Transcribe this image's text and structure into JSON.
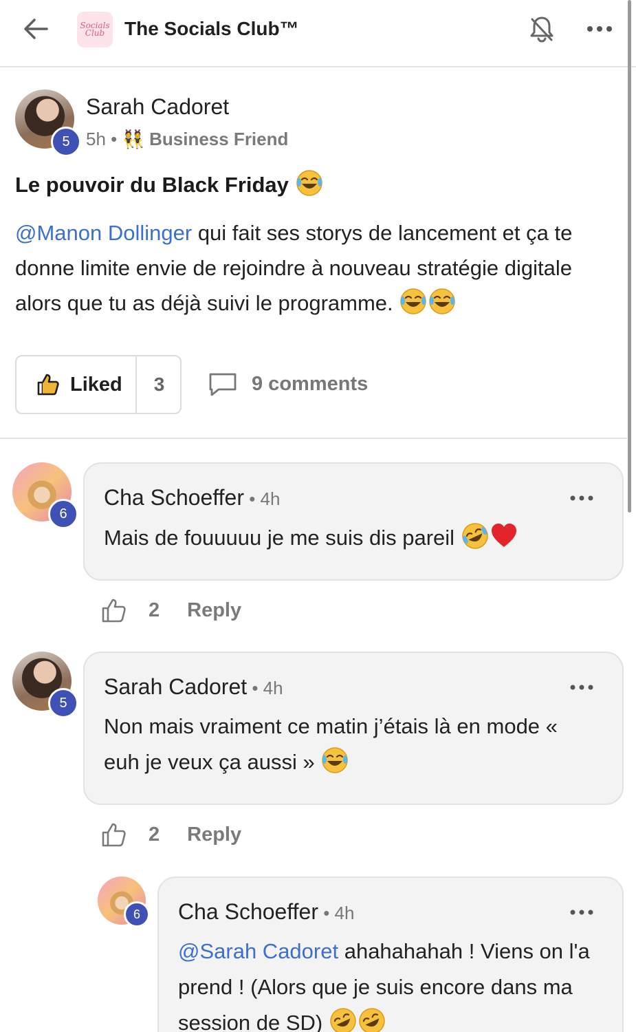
{
  "header": {
    "logo_text": "Socials Club",
    "title": "The Socials Club™",
    "icons": {
      "back": "arrow-left-icon",
      "bell": "bell-off-icon",
      "more": "more-horizontal-icon"
    }
  },
  "post": {
    "author": "Sarah Cadoret",
    "level": "5",
    "time": "5h",
    "separator": "•",
    "role": "Business Friend",
    "title": "Le pouvoir du Black Friday",
    "mention": "@Manon Dollinger",
    "body": " qui fait ses storys de lancement et ça te donne limite envie de rejoindre à nouveau stratégie digitale alors que tu as déjà suivi le programme. ",
    "liked_label": "Liked",
    "like_count": "3",
    "comments_label": "9 comments"
  },
  "comments": [
    {
      "author": "Cha Schoeffer",
      "level": "6",
      "time": " • 4h",
      "text": "Mais de fouuuuu je me suis dis pareil ",
      "likes": "2",
      "reply_label": "Reply"
    },
    {
      "author": "Sarah Cadoret",
      "level": "5",
      "time": " • 4h",
      "text": "Non mais vraiment ce matin j’étais là en mode « euh je veux ça aussi » ",
      "likes": "2",
      "reply_label": "Reply"
    },
    {
      "author": "Cha Schoeffer",
      "level": "6",
      "time": " • 4h",
      "mention": "@Sarah Cadoret",
      "text": " ahahahahah ! Viens on l'a prend ! (Alors que je suis encore dans ma session de SD) "
    }
  ],
  "colors": {
    "accent": "#3c6fcf",
    "badge": "#3f51b5",
    "bubble": "#f3f3f3"
  }
}
